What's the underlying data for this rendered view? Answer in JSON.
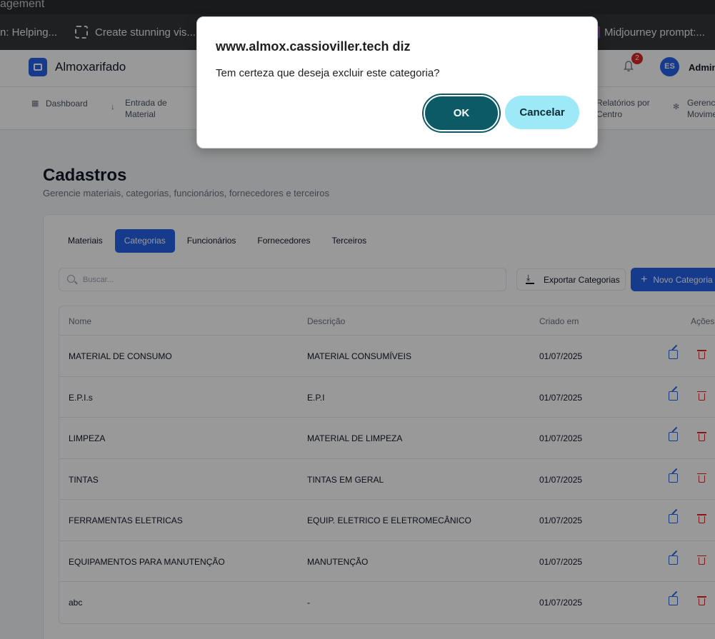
{
  "browser": {
    "title_fragment": "agement",
    "bookmarks": [
      {
        "label": "n: Helping...",
        "icon": "none"
      },
      {
        "label": "Create stunning vis...",
        "icon": "dashed-square-icon"
      },
      {
        "label": "Midjourney prompt:...",
        "icon": "midjourney-icon"
      }
    ]
  },
  "app": {
    "title": "Almoxarifado",
    "notifications_count": "2",
    "avatar_initials": "ES",
    "user_name": "Admini"
  },
  "nav": {
    "dashboard": "Dashboard",
    "entrada_line1": "Entrada de",
    "entrada_line2": "Material",
    "relatorios_line1": "Relatórios por",
    "relatorios_line2": "Centro",
    "gerencia_line1": "Gerencia",
    "gerencia_line2": "Movime"
  },
  "page": {
    "title": "Cadastros",
    "subtitle": "Gerencie materiais, categorias, funcionários, fornecedores e terceiros"
  },
  "tabs": [
    "Materiais",
    "Categorias",
    "Funcionários",
    "Fornecedores",
    "Terceiros"
  ],
  "active_tab": "Categorias",
  "search": {
    "placeholder": "Buscar...",
    "value": ""
  },
  "actions": {
    "export_label": "Exportar Categorias",
    "new_label": "Novo Categoria"
  },
  "table": {
    "headers": {
      "nome": "Nome",
      "descricao": "Descrição",
      "criado_em": "Criado em",
      "acoes": "Ações"
    },
    "rows": [
      {
        "nome": "MATERIAL DE CONSUMO",
        "descricao": "MATERIAL CONSUMÍVEIS",
        "criado_em": "01/07/2025"
      },
      {
        "nome": "E.P.I.s",
        "descricao": "E.P.I",
        "criado_em": "01/07/2025"
      },
      {
        "nome": "LIMPEZA",
        "descricao": "MATERIAL DE LIMPEZA",
        "criado_em": "01/07/2025"
      },
      {
        "nome": "TINTAS",
        "descricao": "TINTAS EM GERAL",
        "criado_em": "01/07/2025"
      },
      {
        "nome": "FERRAMENTAS ELETRICAS",
        "descricao": "EQUIP. ELETRICO E ELETROMECÂNICO",
        "criado_em": "01/07/2025"
      },
      {
        "nome": "EQUIPAMENTOS PARA MANUTENÇÃO",
        "descricao": "MANUTENÇÃO",
        "criado_em": "01/07/2025"
      },
      {
        "nome": "abc",
        "descricao": "-",
        "criado_em": "01/07/2025"
      }
    ]
  },
  "dialog": {
    "title": "www.almox.cassioviller.tech diz",
    "message": "Tem certeza que deseja excluir este categoria?",
    "ok_label": "OK",
    "cancel_label": "Cancelar"
  },
  "colors": {
    "primary": "#2563eb",
    "danger": "#dc2626",
    "ok_button": "#0b5a66",
    "cancel_button": "#9ee9f7"
  }
}
